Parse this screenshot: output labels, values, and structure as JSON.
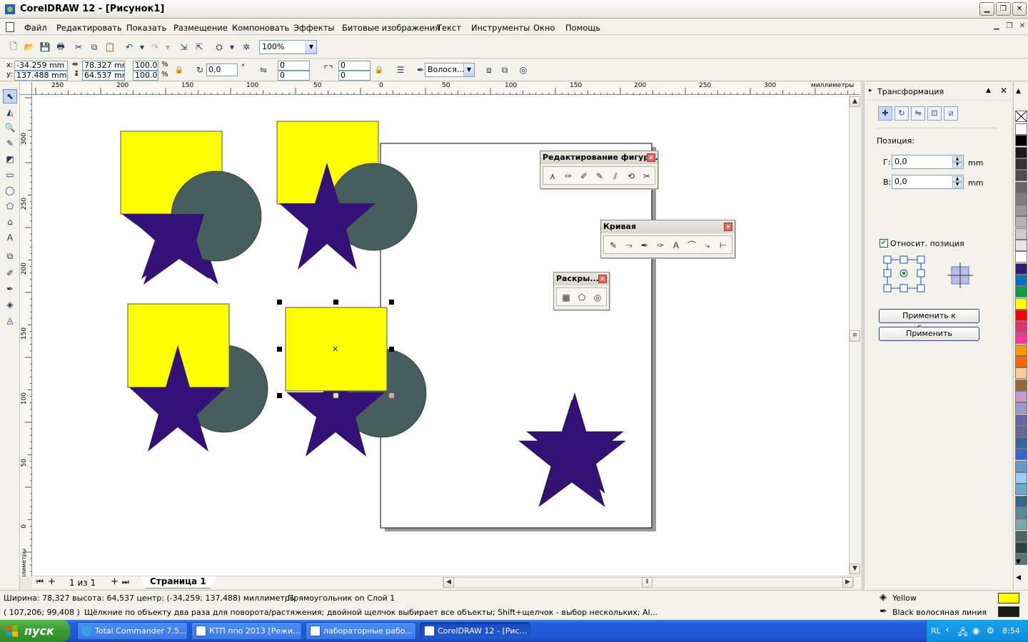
{
  "window": {
    "title": "CorelDRAW 12 - [Рисунок1]"
  },
  "menu": [
    "Файл",
    "Редактировать",
    "Показать",
    "Размещение",
    "Компоновать",
    "Эффекты",
    "Битовые изображения",
    "Текст",
    "Инструменты",
    "Окно",
    "Помощь"
  ],
  "toolbar": {
    "zoom": "100%"
  },
  "propbar": {
    "x": "-34.259 mm",
    "y": "137.488 mm",
    "width": "78.327 mm",
    "height": "64.537 mm",
    "scale_x": "100.0",
    "scale_y": "100.0",
    "percent": "%",
    "angle": "0,0",
    "degree": "°",
    "corner_1": "0",
    "corner_2": "0",
    "corner_3": "0",
    "corner_4": "0",
    "outline": "Волося..."
  },
  "rulers": {
    "h_ticks": [
      "250",
      "200",
      "150",
      "100",
      "50",
      "0",
      "50",
      "100",
      "150",
      "200",
      "250",
      "300"
    ],
    "h_unit": "миллиметры",
    "v_ticks": [
      "300",
      "250",
      "200",
      "150",
      "100",
      "50",
      "0"
    ],
    "v_unit": "миллиметры"
  },
  "float_toolbars": {
    "shape_edit": "Редактирование фигур...",
    "curve": "Кривая",
    "cut": "Раскры..."
  },
  "docker": {
    "title": "Трансформация",
    "position_label": "Позиция:",
    "h_label": "Г:",
    "h_value": "0,0",
    "v_label": "В:",
    "v_value": "0,0",
    "unit": "mm",
    "relative_label": "Относит. позиция",
    "relative_checked": true,
    "apply_dup": "Применить к дубликату",
    "apply": "Применить"
  },
  "pages": {
    "counter": "1 из 1",
    "tab": "Страница 1"
  },
  "status": {
    "dims": "Ширина: 78,327  высота: 64,537  центр: (-34,259; 137,488)  миллиметры",
    "object": "Прямоугольник on Слой 1",
    "cursor": "( 107,206; 99,408 )",
    "hint": "Щёлкние по объекту два раза для поворота/растяжения; двойной щелчок выбирает все объекты; Shift+щелчок - выбор нескольких; Al...",
    "fill_name": "Yellow",
    "outline_name": "Black  волосяная линия",
    "fill_color": "#ffff00",
    "outline_color": "#1a1a1a"
  },
  "taskbar": {
    "start": "пуск",
    "tasks": [
      "Total Commander 7.5...",
      "КТП ппо 2013 [Режи...",
      "лабораторные рабо...",
      "CorelDRAW 12 - [Рис..."
    ],
    "lang": "RL",
    "clock": "8:54"
  },
  "colors": {
    "yellow": "#ffff00",
    "star": "#331177",
    "circle": "#465e5c",
    "palette": [
      "#ffffff",
      "#000000",
      "#1a1a1a",
      "#333333",
      "#4d4d4d",
      "#666666",
      "#808080",
      "#999999",
      "#b3b3b3",
      "#cccccc",
      "#e6e6e6",
      "#ffffff",
      "#2e1a7a",
      "#0070c0",
      "#00a04a",
      "#ffff00",
      "#ff0000",
      "#e0306e",
      "#ff3399",
      "#ff9900",
      "#ff6600",
      "#ffcc99",
      "#996633",
      "#cc99cc",
      "#9999cc",
      "#6666aa",
      "#666699",
      "#336699",
      "#3366cc",
      "#6699cc",
      "#99ccff",
      "#66aacc",
      "#336688",
      "#558899",
      "#77aaaa",
      "#446666",
      "#224444",
      "#557777"
    ]
  }
}
